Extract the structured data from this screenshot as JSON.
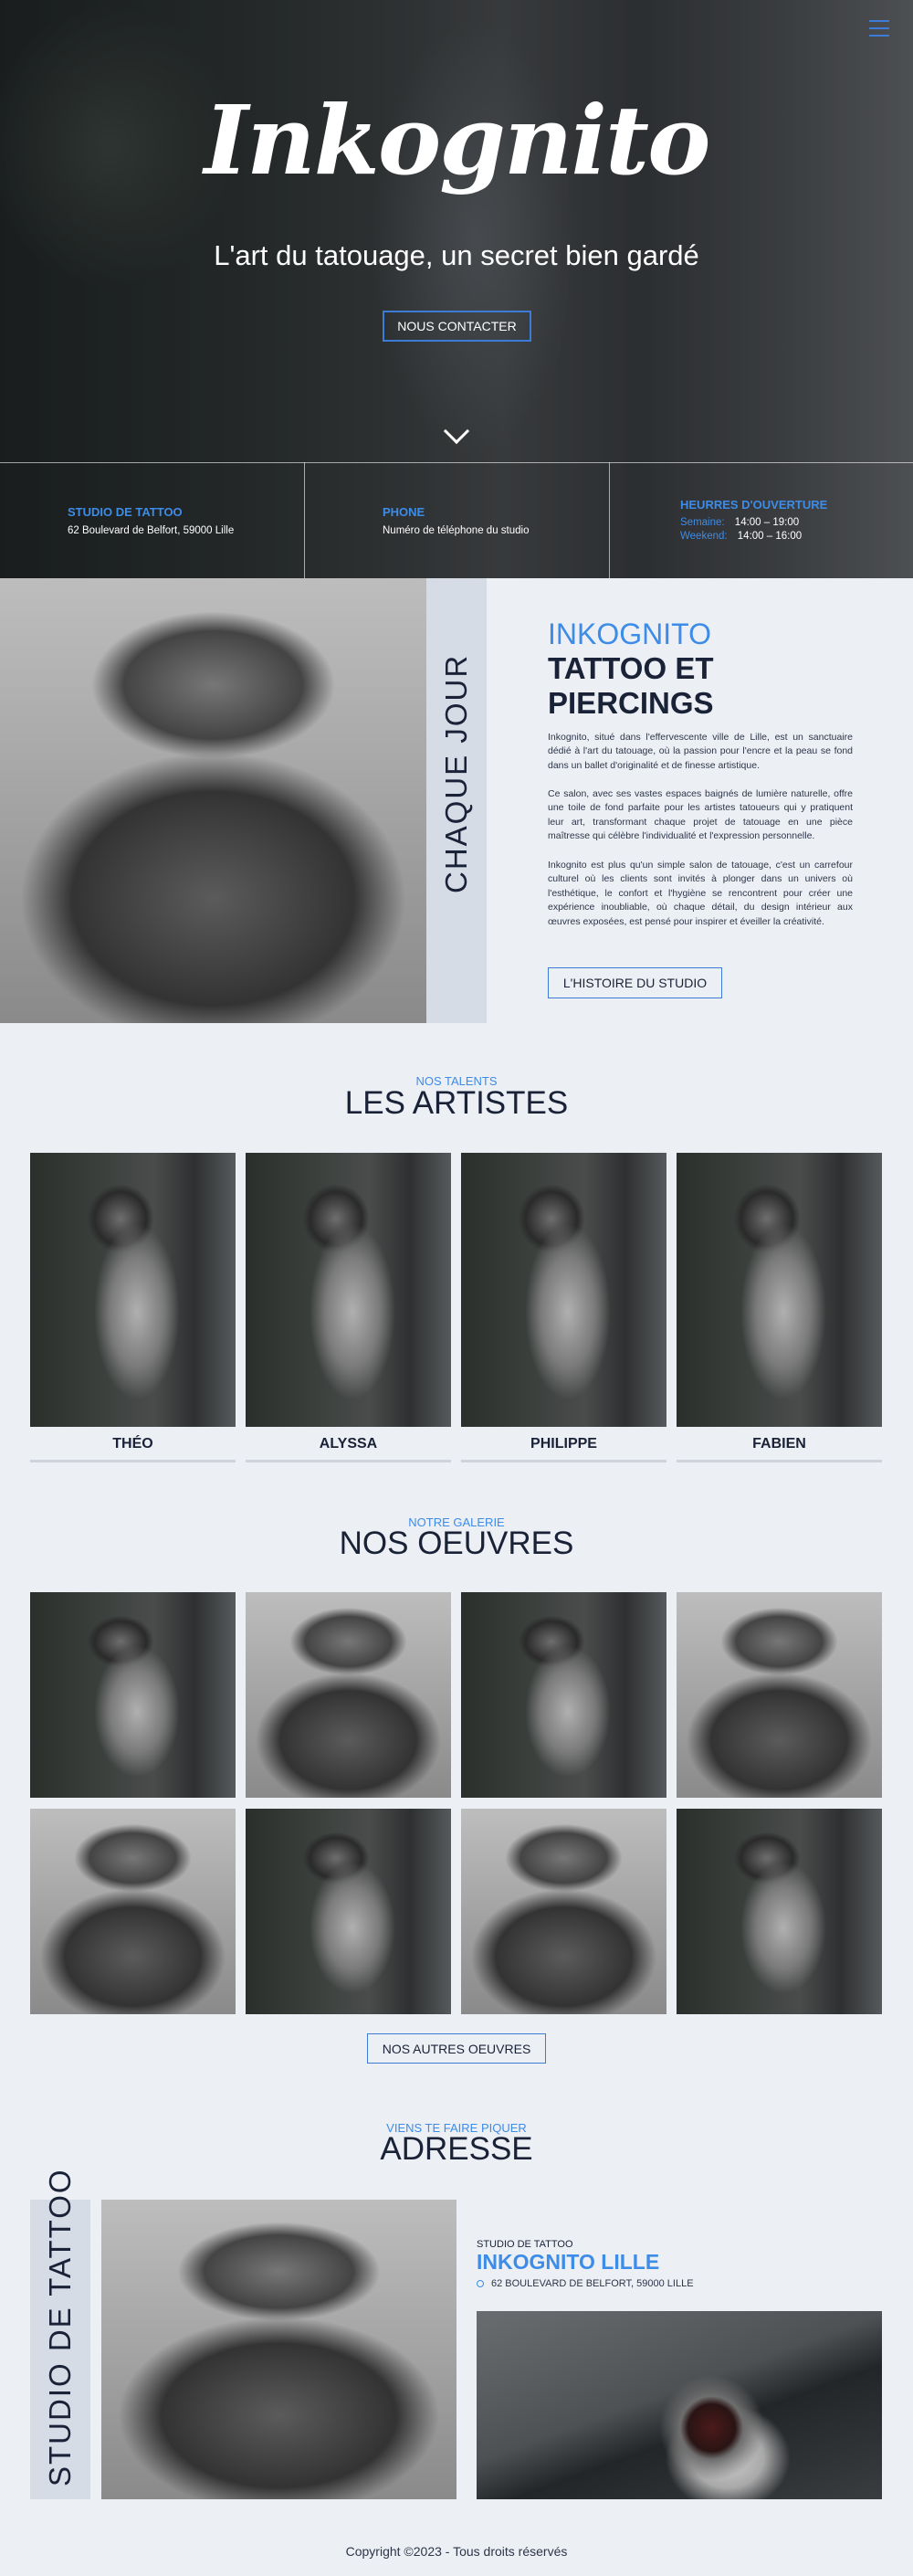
{
  "hero": {
    "title": "Inkognito",
    "subtitle": "L'art du tatouage, un secret bien gardé",
    "contact_button": "NOUS CONTACTER"
  },
  "info_bar": {
    "studio_title": "STUDIO DE TATTOO",
    "studio_address": "62 Boulevard de Belfort, 59000 Lille",
    "phone_title": "PHONE",
    "phone_text": "Numéro de téléphone du studio",
    "hours_title": "HEURRES D'OUVERTURE",
    "hours": [
      {
        "day": "Semaine:",
        "time": "14:00 – 19:00"
      },
      {
        "day": "Weekend:",
        "time": "14:00 – 16:00"
      }
    ]
  },
  "about": {
    "side_label": "CHAQUE JOUR",
    "kicker": "INKOGNITO",
    "title": "TATTOO ET PIERCINGS",
    "paragraphs": [
      "Inkognito, situé dans l'effervescente ville de Lille, est un sanctuaire dédié à l'art du tatouage, où la passion pour l'encre et la peau se fond dans un ballet d'originalité et de finesse artistique.",
      "Ce salon, avec ses vastes espaces baignés de lumière naturelle, offre une toile de fond parfaite pour les artistes tatoueurs qui y pratiquent leur art, transformant chaque projet de tatouage en une pièce maîtresse qui célèbre l'individualité et l'expression personnelle.",
      "Inkognito est plus qu'un simple salon de tatouage, c'est un carrefour culturel où les clients sont invités à plonger dans un univers où l'esthétique, le confort et l'hygiène se rencontrent pour créer une expérience inoubliable, où chaque détail, du design intérieur aux œuvres exposées, est pensé pour inspirer et éveiller la créativité."
    ],
    "button": "L'HISTOIRE DU STUDIO"
  },
  "artists": {
    "kicker": "NOS TALENTS",
    "title": "LES ARTISTES",
    "names": [
      "THÉO",
      "ALYSSA",
      "PHILIPPE",
      "FABIEN"
    ]
  },
  "gallery": {
    "kicker": "NOTRE GALERIE",
    "title": "NOS OEUVRES",
    "button": "NOS AUTRES OEUVRES"
  },
  "address": {
    "kicker": "VIENS TE FAIRE PIQUER",
    "title": "ADRESSE",
    "side_label": "STUDIO DE TATTOO",
    "small_label": "STUDIO DE TATTOO",
    "studio_name": "INKOGNITO LILLE",
    "street": "62 BOULEVARD DE BELFORT, 59000 LILLE"
  },
  "footer": {
    "copyright": "Copyright ©2023 - Tous droits réservés"
  }
}
